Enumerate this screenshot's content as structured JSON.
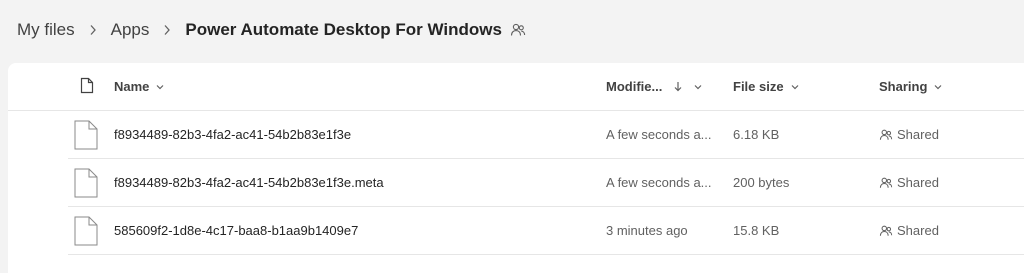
{
  "breadcrumb": {
    "items": [
      "My files",
      "Apps"
    ],
    "current": "Power Automate Desktop For Windows"
  },
  "columns": {
    "name": "Name",
    "modified": "Modifie...",
    "size": "File size",
    "sharing": "Sharing"
  },
  "rows": [
    {
      "name": "f8934489-82b3-4fa2-ac41-54b2b83e1f3e",
      "modified": "A few seconds a...",
      "size": "6.18 KB",
      "sharing": "Shared"
    },
    {
      "name": "f8934489-82b3-4fa2-ac41-54b2b83e1f3e.meta",
      "modified": "A few seconds a...",
      "size": "200 bytes",
      "sharing": "Shared"
    },
    {
      "name": "585609f2-1d8e-4c17-baa8-b1aa9b1409e7",
      "modified": "3 minutes ago",
      "size": "15.8 KB",
      "sharing": "Shared"
    }
  ],
  "icons": {
    "separator": "chevron-right-icon",
    "shared": "people-icon",
    "file": "document-icon",
    "sort": "arrow-down-icon"
  },
  "colors": {
    "background": "#f3f3f3",
    "panel": "#ffffff",
    "text": "#242424",
    "muted": "#616161",
    "divider": "#e6e6e6"
  }
}
